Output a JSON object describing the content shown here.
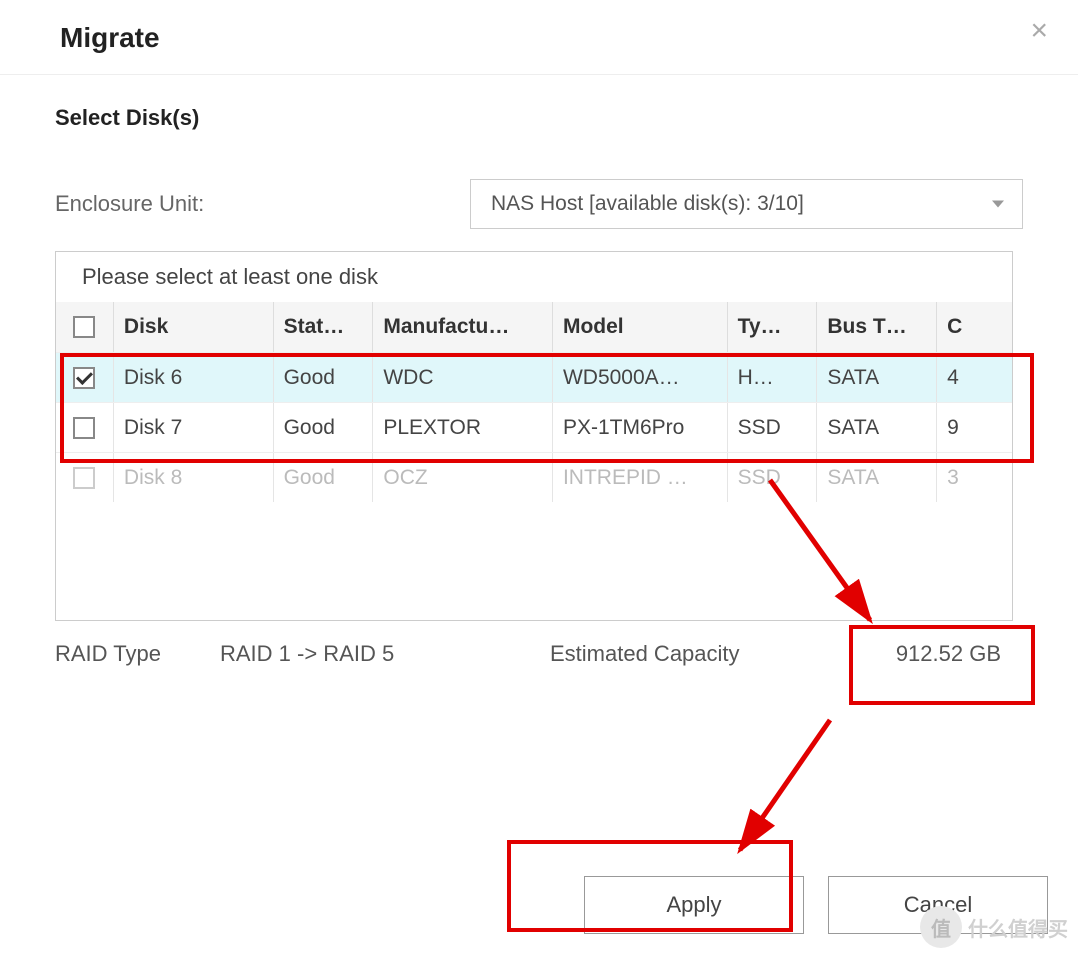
{
  "header": {
    "title": "Migrate"
  },
  "subtitle": "Select Disk(s)",
  "enclosure": {
    "label": "Enclosure Unit:",
    "selected": "NAS Host [available disk(s): 3/10]"
  },
  "table": {
    "instruction": "Please select at least one disk",
    "columns": [
      "Disk",
      "Stat…",
      "Manufactu…",
      "Model",
      "Ty…",
      "Bus T…",
      "C"
    ],
    "rows": [
      {
        "checked": true,
        "selected": true,
        "disabled": false,
        "disk": "Disk 6",
        "status": "Good",
        "manufacturer": "WDC",
        "model": "WD5000A…",
        "type": "H…",
        "bus": "SATA",
        "cap": "4"
      },
      {
        "checked": false,
        "selected": false,
        "disabled": false,
        "disk": "Disk 7",
        "status": "Good",
        "manufacturer": "PLEXTOR",
        "model": "PX-1TM6Pro",
        "type": "SSD",
        "bus": "SATA",
        "cap": "9"
      },
      {
        "checked": false,
        "selected": false,
        "disabled": true,
        "disk": "Disk 8",
        "status": "Good",
        "manufacturer": "OCZ",
        "model": "INTREPID …",
        "type": "SSD",
        "bus": "SATA",
        "cap": "3"
      }
    ]
  },
  "summary": {
    "raid_type_label": "RAID Type",
    "raid_type_value": "RAID 1 -> RAID 5",
    "capacity_label": "Estimated Capacity",
    "capacity_value": "912.52 GB"
  },
  "buttons": {
    "apply": "Apply",
    "cancel": "Cancel"
  },
  "watermark": {
    "icon": "值",
    "text": "什么值得买"
  }
}
